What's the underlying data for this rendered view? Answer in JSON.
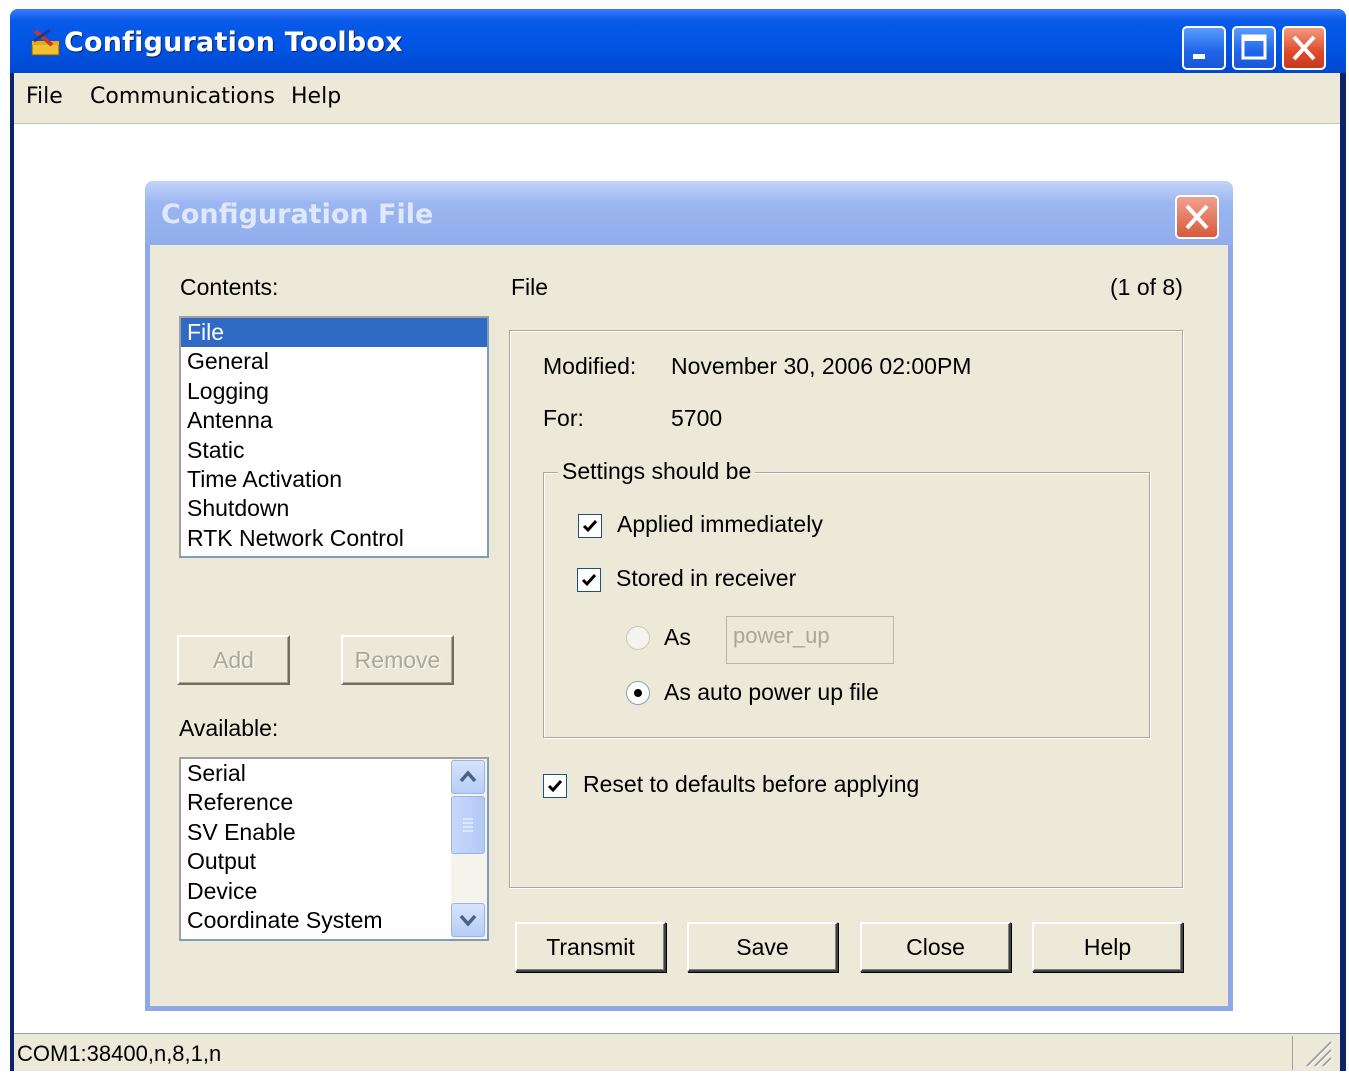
{
  "window": {
    "title": "Configuration Toolbox",
    "icons": {
      "app": "toolbox-icon",
      "minimize": "minimize-icon",
      "maximize": "maximize-icon",
      "close": "close-icon"
    }
  },
  "menu": {
    "file": "File",
    "communications": "Communications",
    "help": "Help"
  },
  "status": {
    "text": "COM1:38400,n,8,1,n"
  },
  "dialog": {
    "title": "Configuration File",
    "contents_label": "Contents:",
    "contents_items": [
      "File",
      "General",
      "Logging",
      "Antenna",
      "Static",
      "Time Activation",
      "Shutdown",
      "RTK Network Control"
    ],
    "contents_selected": "File",
    "add_label": "Add",
    "remove_label": "Remove",
    "available_label": "Available:",
    "available_items": [
      "Serial",
      "Reference",
      "SV Enable",
      "Output",
      "Device",
      "Coordinate System"
    ],
    "section_title": "File",
    "page_indicator": "(1 of 8)",
    "modified_label": "Modified:",
    "modified_value": "November 30, 2006 02:00PM",
    "for_label": "For:",
    "for_value": "5700",
    "settings_group": "Settings should be",
    "applied_label": "Applied immediately",
    "applied_checked": true,
    "stored_label": "Stored in receiver",
    "stored_checked": true,
    "as_label": "As",
    "as_value": "power_up",
    "auto_label": "As auto power up file",
    "auto_selected": true,
    "reset_label": "Reset to defaults before applying",
    "reset_checked": true,
    "buttons": {
      "transmit": "Transmit",
      "save": "Save",
      "close": "Close",
      "help": "Help"
    }
  }
}
